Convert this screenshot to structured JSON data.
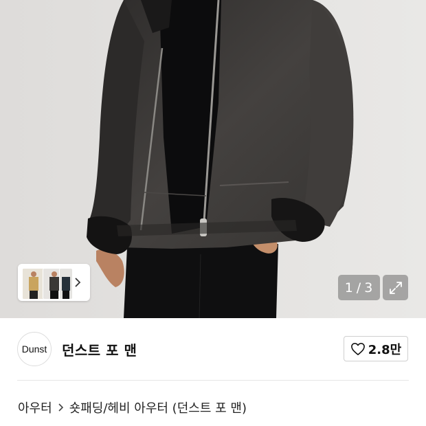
{
  "gallery": {
    "current": "1",
    "total": "3",
    "counter_separator": "/",
    "thumbnail_count": 3,
    "expand_icon": "expand-icon",
    "thumb_chevron_icon": "chevron-right-icon"
  },
  "brand": {
    "logo_text": "Dunst",
    "name": "던스트 포 맨"
  },
  "like": {
    "icon": "heart-icon",
    "count": "2.8만"
  },
  "breadcrumb": {
    "items": [
      "아우터",
      "숏패딩/헤비 아우터 (던스트 포 맨)"
    ],
    "separator_icon": "chevron-right-icon"
  },
  "colors": {
    "hero_background": "#e3e2e0",
    "jacket": "#3a3836",
    "text": "#111111",
    "overlay": "#6e6e6e"
  }
}
